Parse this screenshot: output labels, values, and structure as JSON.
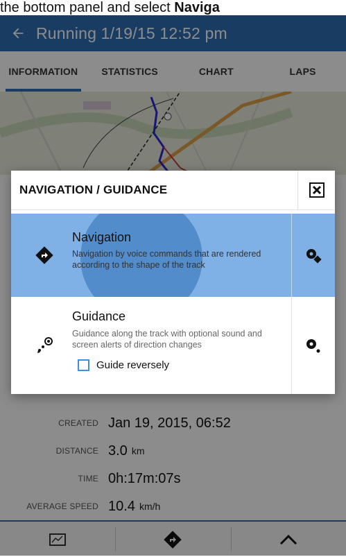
{
  "caption": {
    "lead": "the bottom panel and select ",
    "bold": "Naviga"
  },
  "appbar": {
    "title": "Running 1/19/15 12:52 pm"
  },
  "tabs": [
    {
      "label": "INFORMATION",
      "active": true
    },
    {
      "label": "STATISTICS"
    },
    {
      "label": "CHART"
    },
    {
      "label": "LAPS"
    }
  ],
  "details": [
    {
      "label": "CREATED",
      "value": "Jan 19, 2015, 06:52",
      "unit": ""
    },
    {
      "label": "DISTANCE",
      "value": "3.0",
      "unit": "km"
    },
    {
      "label": "TIME",
      "value": "0h:17m:07s",
      "unit": ""
    },
    {
      "label": "AVERAGE SPEED",
      "value": "10.4",
      "unit": "km/h"
    }
  ],
  "dialog": {
    "title": "NAVIGATION / GUIDANCE",
    "navigation": {
      "title": "Navigation",
      "description": "Navigation by voice commands that are rendered according to the shape of the track"
    },
    "guidance": {
      "title": "Guidance",
      "description": "Guidance along the track with optional sound and screen alerts of direction changes",
      "checkbox_label": "Guide reversely",
      "checked": false
    }
  },
  "colors": {
    "primary": "#2f6fb2",
    "selected": "#7fb0e6",
    "checkbox": "#3d8fe0"
  },
  "icons": {
    "back": "arrow-left-icon",
    "close": "close-icon",
    "navigation": "navigation-diamond-icon",
    "guidance": "guidance-path-icon",
    "map": "map-icon",
    "expand": "chevron-up-icon"
  }
}
